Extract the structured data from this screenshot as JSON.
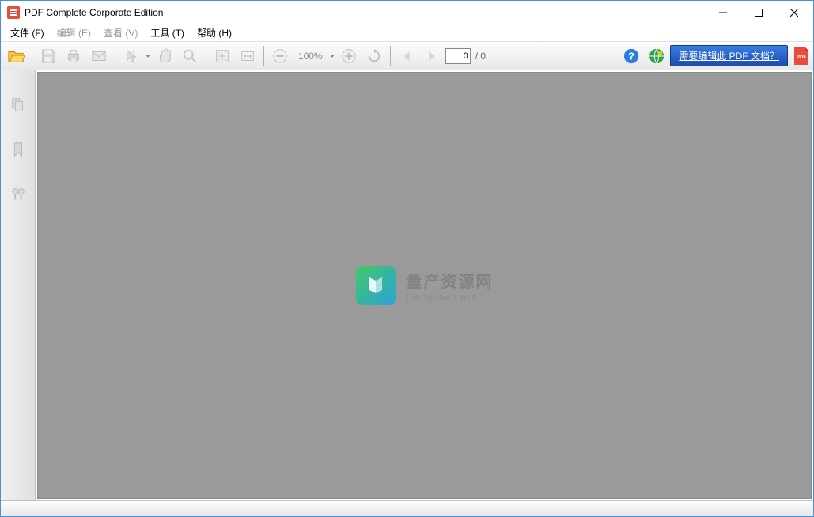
{
  "window": {
    "title": "PDF Complete Corporate Edition"
  },
  "menu": {
    "file": "文件 (F)",
    "edit": "编辑 (E)",
    "view": "查看 (V)",
    "tools": "工具 (T)",
    "help": "帮助 (H)"
  },
  "toolbar": {
    "zoom_pct": "100%",
    "page_current": "0",
    "page_total": "/ 0",
    "promo_label": "需要编辑此 PDF 文档？"
  },
  "watermark": {
    "line1": "量产资源网",
    "line2": "Liangchan.net"
  }
}
